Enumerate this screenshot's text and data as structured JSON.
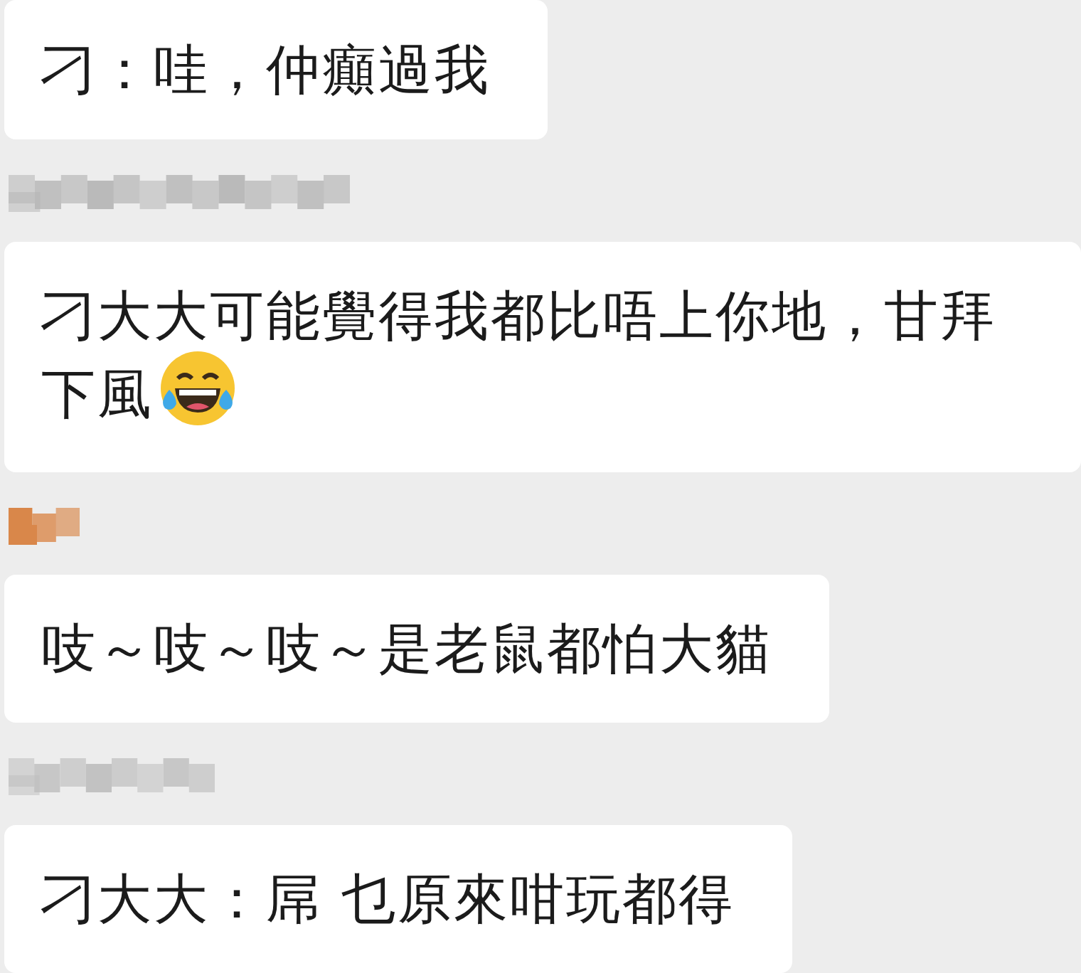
{
  "messages": [
    {
      "text": "刁：哇，仲癲過我",
      "trailing_emoji": false
    },
    {
      "redacted_sender": {
        "color": "#b4b4b4",
        "kind": "wide"
      },
      "text": "刁大大可能覺得我都比唔上你地，甘拜下風",
      "trailing_emoji": true
    },
    {
      "redacted_sender": {
        "color": "#d9874a",
        "kind": "small"
      },
      "text": "吱～吱～吱～是老鼠都怕大貓",
      "trailing_emoji": false
    },
    {
      "redacted_sender": {
        "color": "#bdbdbd",
        "kind": "medium"
      },
      "text": "刁大大：屌 乜原來咁玩都得",
      "trailing_emoji": false
    }
  ]
}
